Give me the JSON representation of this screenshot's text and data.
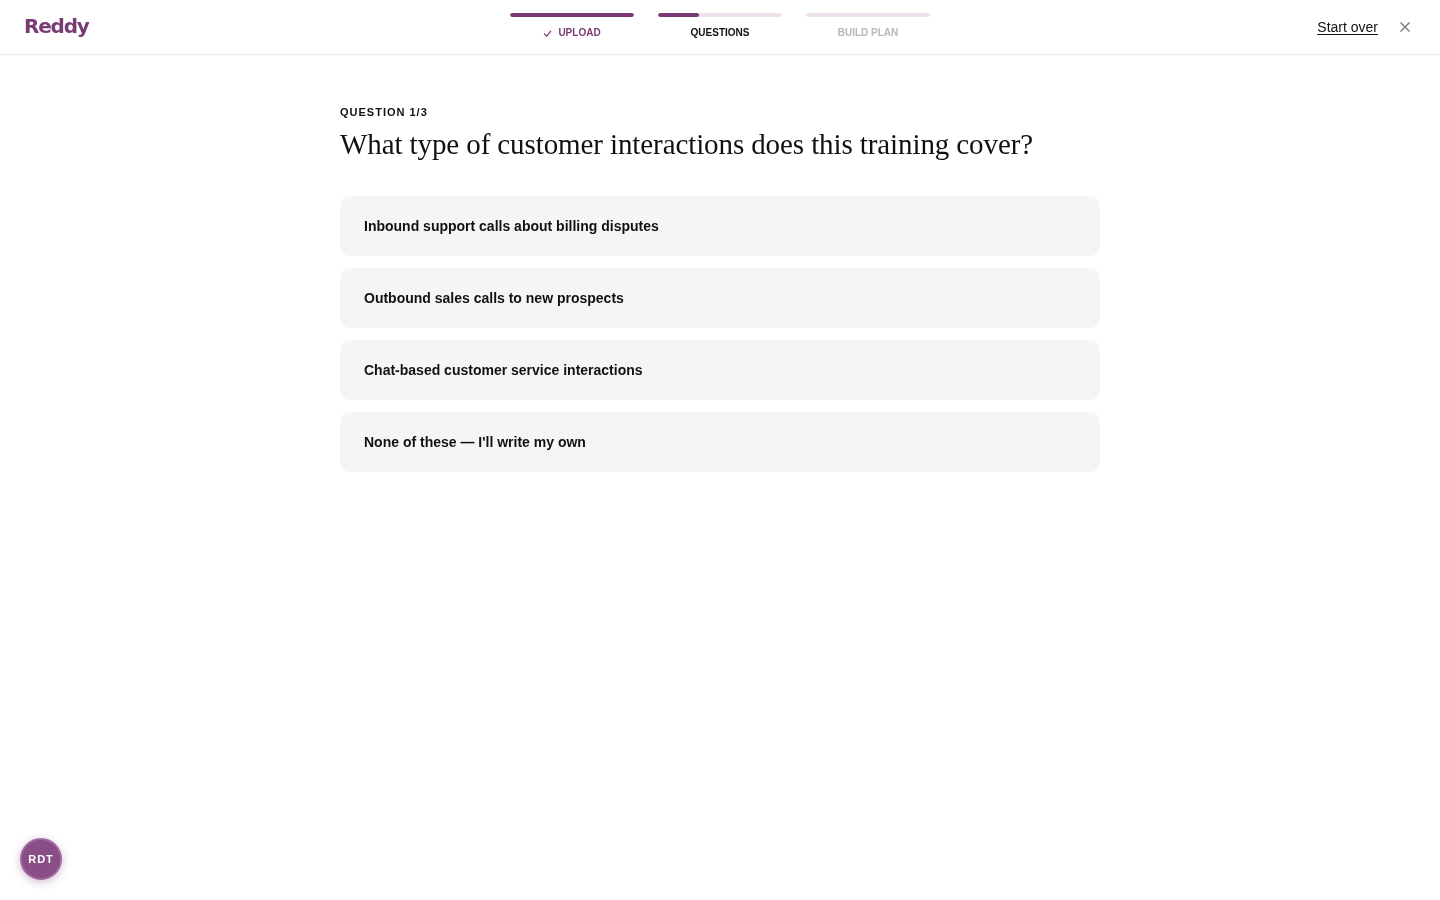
{
  "header": {
    "logo": "Reddy",
    "steps": [
      {
        "label": "UPLOAD",
        "completed": true,
        "selected": false,
        "level": 1
      },
      {
        "label": "QUESTIONS",
        "completed": false,
        "selected": true,
        "level": 0.33
      },
      {
        "label": "BUILD PLAN",
        "completed": false,
        "selected": false
      }
    ],
    "start_over": "Start over"
  },
  "question": {
    "counter": "QUESTION 1/3",
    "title": "What type of customer interactions does this training cover?",
    "options": [
      {
        "label": "Inbound support calls about billing disputes",
        "selected": false
      },
      {
        "label": "Outbound sales calls to new prospects",
        "selected": false
      },
      {
        "label": "Chat-based customer service interactions",
        "selected": false
      },
      {
        "label": "None of these — I'll write my own",
        "selected": false
      }
    ]
  },
  "user_badge": {
    "initials": "RDT"
  }
}
